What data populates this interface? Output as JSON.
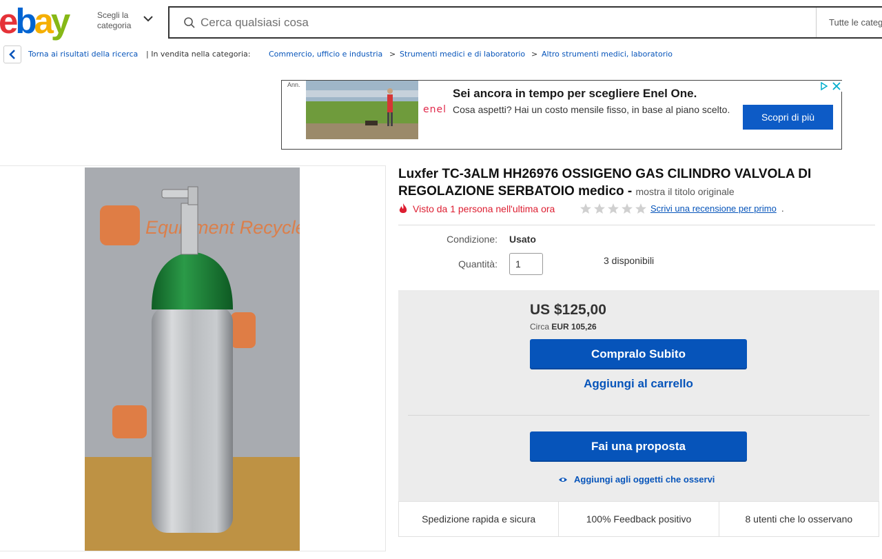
{
  "header": {
    "logo": {
      "e": "e",
      "b": "b",
      "a": "a",
      "y": "y"
    },
    "category_button": "Scegli la categoria",
    "search_placeholder": "Cerca qualsiasi cosa",
    "category_select": "Tutte le categorie"
  },
  "breadcrumb": {
    "back": "Torna ai risultati della ricerca",
    "separator_text": "| In vendita nella categoria:",
    "items": [
      "Commercio, ufficio e industria",
      "Strumenti medici e di laboratorio",
      "Altro strumenti medici, laboratorio"
    ],
    "arrow": ">"
  },
  "ad": {
    "label": "Ann.",
    "brand": "enel",
    "headline": "Sei ancora in tempo per scegliere Enel One.",
    "body": "Cosa aspetti? Hai un costo mensile fisso, in base al piano scelto.",
    "cta": "Scopri di più"
  },
  "product": {
    "title": "Luxfer TC-3ALM HH26976 OSSIGENO GAS CILINDRO VALVOLA DI REGOLAZIONE SERBATOIO medico",
    "title_dash": "-",
    "show_original": "mostra il titolo originale",
    "seen": "Visto da 1 persona nell'ultima ora",
    "review_link": "Scrivi una recensione per primo",
    "review_suffix": ".",
    "rating_stars": 0,
    "condition_label": "Condizione:",
    "condition_value": "Usato",
    "quantity_label": "Quantità:",
    "quantity_value": "1",
    "available": "3 disponibili",
    "image_watermark": "Equipment Recycle"
  },
  "buybox": {
    "price": "US $125,00",
    "approx_prefix": "Circa",
    "approx_value": "EUR 105,26",
    "buy_now": "Compralo Subito",
    "add_to_cart": "Aggiungi al carrello",
    "make_offer": "Fai una proposta",
    "watch": "Aggiungi agli oggetti che osservi"
  },
  "trust": [
    "Spedizione rapida e sicura",
    "100% Feedback positivo",
    "8 utenti che lo osservano"
  ],
  "colors": {
    "link": "#0654ba",
    "button": "#0654ba",
    "alert": "#dd1e31",
    "cylinder_top": "#1f8a3a"
  }
}
